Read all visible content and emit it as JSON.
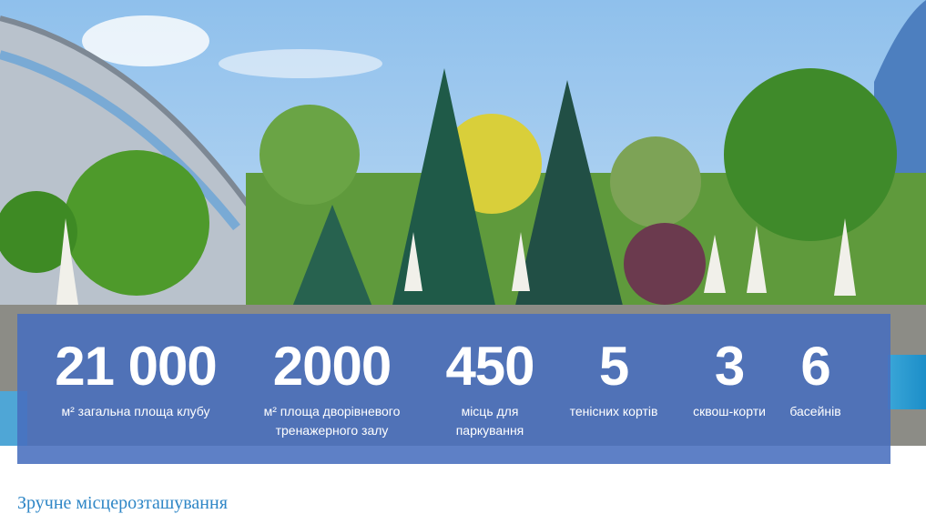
{
  "stats": [
    {
      "value": "21 000",
      "label": "м² загальна площа клубу"
    },
    {
      "value": "2000",
      "label": "м² площа дворівневого тренажерного залу"
    },
    {
      "value": "450",
      "label": "місць для паркування"
    },
    {
      "value": "5",
      "label": "тенісних кортів"
    },
    {
      "value": "3",
      "label": "сквош-корти"
    },
    {
      "value": "6",
      "label": "басейнів"
    }
  ],
  "section_heading": "Зручне місцерозташування",
  "colors": {
    "panel": "#486ebe",
    "heading": "#2e86c6",
    "sky": "#a8cdf0"
  }
}
